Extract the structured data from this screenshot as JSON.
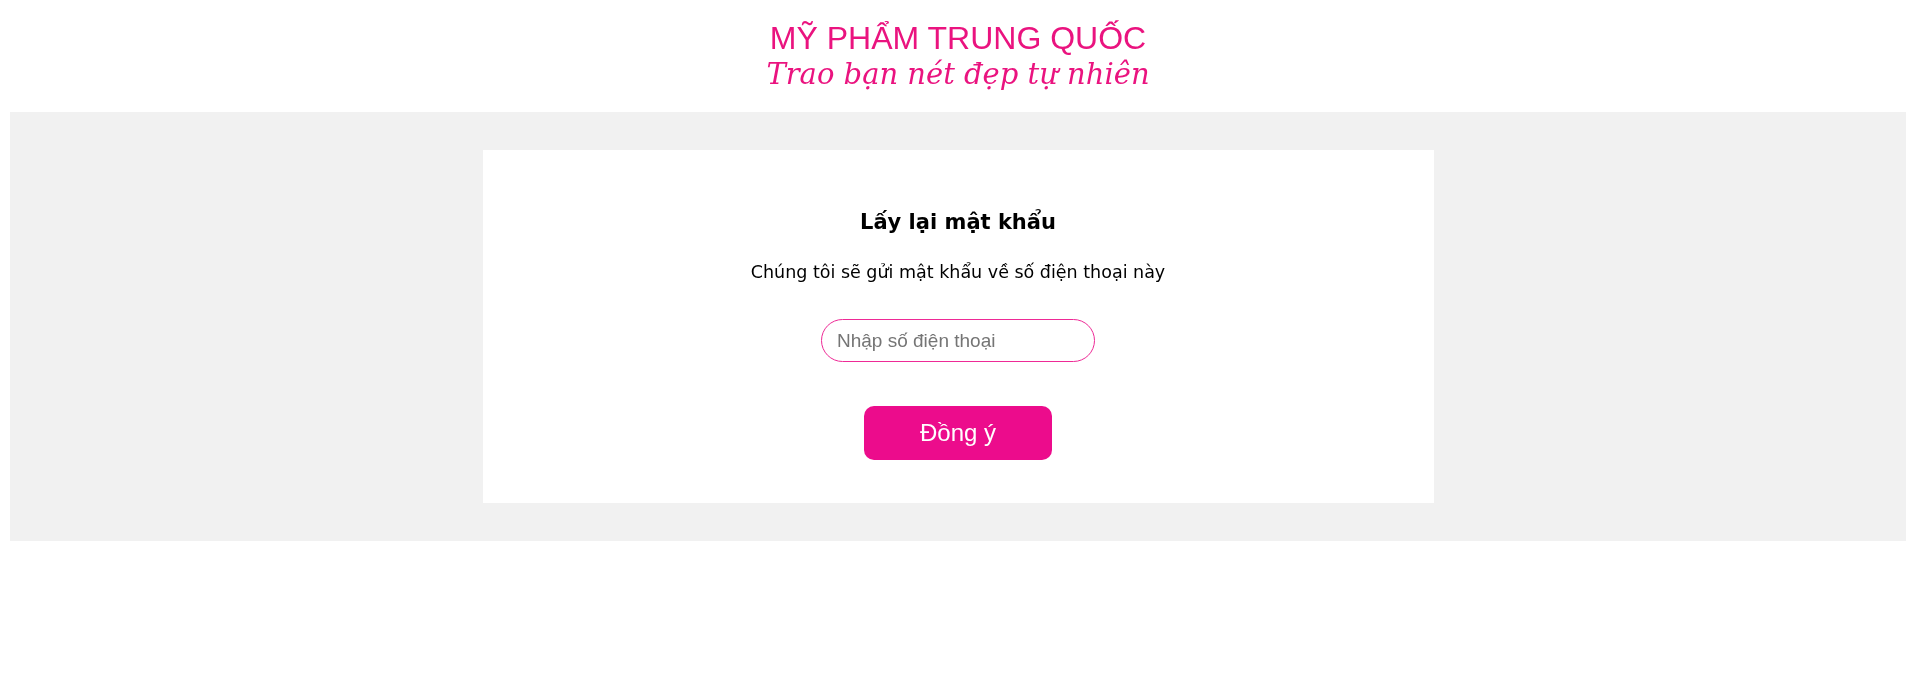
{
  "header": {
    "brand": "MỸ PHẨM TRUNG QUỐC",
    "tagline": "Trao bạn nét đẹp tự nhiên"
  },
  "form": {
    "title": "Lấy lại mật khẩu",
    "description": "Chúng tôi sẽ gửi mật khẩu về số điện thoại này",
    "phone_field": {
      "placeholder": "Nhập số điện thoại"
    },
    "submit_button": "Đồng ý"
  }
}
